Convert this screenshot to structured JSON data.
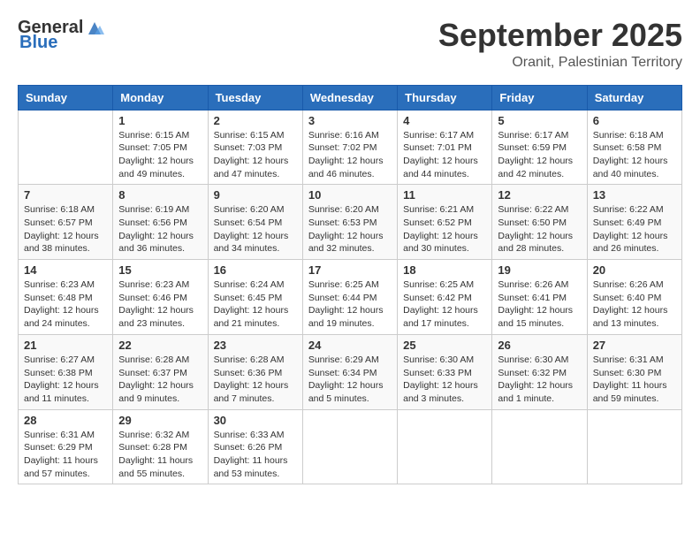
{
  "logo": {
    "general": "General",
    "blue": "Blue"
  },
  "header": {
    "month": "September 2025",
    "location": "Oranit, Palestinian Territory"
  },
  "weekdays": [
    "Sunday",
    "Monday",
    "Tuesday",
    "Wednesday",
    "Thursday",
    "Friday",
    "Saturday"
  ],
  "weeks": [
    [
      {
        "day": "",
        "info": ""
      },
      {
        "day": "1",
        "info": "Sunrise: 6:15 AM\nSunset: 7:05 PM\nDaylight: 12 hours\nand 49 minutes."
      },
      {
        "day": "2",
        "info": "Sunrise: 6:15 AM\nSunset: 7:03 PM\nDaylight: 12 hours\nand 47 minutes."
      },
      {
        "day": "3",
        "info": "Sunrise: 6:16 AM\nSunset: 7:02 PM\nDaylight: 12 hours\nand 46 minutes."
      },
      {
        "day": "4",
        "info": "Sunrise: 6:17 AM\nSunset: 7:01 PM\nDaylight: 12 hours\nand 44 minutes."
      },
      {
        "day": "5",
        "info": "Sunrise: 6:17 AM\nSunset: 6:59 PM\nDaylight: 12 hours\nand 42 minutes."
      },
      {
        "day": "6",
        "info": "Sunrise: 6:18 AM\nSunset: 6:58 PM\nDaylight: 12 hours\nand 40 minutes."
      }
    ],
    [
      {
        "day": "7",
        "info": "Sunrise: 6:18 AM\nSunset: 6:57 PM\nDaylight: 12 hours\nand 38 minutes."
      },
      {
        "day": "8",
        "info": "Sunrise: 6:19 AM\nSunset: 6:56 PM\nDaylight: 12 hours\nand 36 minutes."
      },
      {
        "day": "9",
        "info": "Sunrise: 6:20 AM\nSunset: 6:54 PM\nDaylight: 12 hours\nand 34 minutes."
      },
      {
        "day": "10",
        "info": "Sunrise: 6:20 AM\nSunset: 6:53 PM\nDaylight: 12 hours\nand 32 minutes."
      },
      {
        "day": "11",
        "info": "Sunrise: 6:21 AM\nSunset: 6:52 PM\nDaylight: 12 hours\nand 30 minutes."
      },
      {
        "day": "12",
        "info": "Sunrise: 6:22 AM\nSunset: 6:50 PM\nDaylight: 12 hours\nand 28 minutes."
      },
      {
        "day": "13",
        "info": "Sunrise: 6:22 AM\nSunset: 6:49 PM\nDaylight: 12 hours\nand 26 minutes."
      }
    ],
    [
      {
        "day": "14",
        "info": "Sunrise: 6:23 AM\nSunset: 6:48 PM\nDaylight: 12 hours\nand 24 minutes."
      },
      {
        "day": "15",
        "info": "Sunrise: 6:23 AM\nSunset: 6:46 PM\nDaylight: 12 hours\nand 23 minutes."
      },
      {
        "day": "16",
        "info": "Sunrise: 6:24 AM\nSunset: 6:45 PM\nDaylight: 12 hours\nand 21 minutes."
      },
      {
        "day": "17",
        "info": "Sunrise: 6:25 AM\nSunset: 6:44 PM\nDaylight: 12 hours\nand 19 minutes."
      },
      {
        "day": "18",
        "info": "Sunrise: 6:25 AM\nSunset: 6:42 PM\nDaylight: 12 hours\nand 17 minutes."
      },
      {
        "day": "19",
        "info": "Sunrise: 6:26 AM\nSunset: 6:41 PM\nDaylight: 12 hours\nand 15 minutes."
      },
      {
        "day": "20",
        "info": "Sunrise: 6:26 AM\nSunset: 6:40 PM\nDaylight: 12 hours\nand 13 minutes."
      }
    ],
    [
      {
        "day": "21",
        "info": "Sunrise: 6:27 AM\nSunset: 6:38 PM\nDaylight: 12 hours\nand 11 minutes."
      },
      {
        "day": "22",
        "info": "Sunrise: 6:28 AM\nSunset: 6:37 PM\nDaylight: 12 hours\nand 9 minutes."
      },
      {
        "day": "23",
        "info": "Sunrise: 6:28 AM\nSunset: 6:36 PM\nDaylight: 12 hours\nand 7 minutes."
      },
      {
        "day": "24",
        "info": "Sunrise: 6:29 AM\nSunset: 6:34 PM\nDaylight: 12 hours\nand 5 minutes."
      },
      {
        "day": "25",
        "info": "Sunrise: 6:30 AM\nSunset: 6:33 PM\nDaylight: 12 hours\nand 3 minutes."
      },
      {
        "day": "26",
        "info": "Sunrise: 6:30 AM\nSunset: 6:32 PM\nDaylight: 12 hours\nand 1 minute."
      },
      {
        "day": "27",
        "info": "Sunrise: 6:31 AM\nSunset: 6:30 PM\nDaylight: 11 hours\nand 59 minutes."
      }
    ],
    [
      {
        "day": "28",
        "info": "Sunrise: 6:31 AM\nSunset: 6:29 PM\nDaylight: 11 hours\nand 57 minutes."
      },
      {
        "day": "29",
        "info": "Sunrise: 6:32 AM\nSunset: 6:28 PM\nDaylight: 11 hours\nand 55 minutes."
      },
      {
        "day": "30",
        "info": "Sunrise: 6:33 AM\nSunset: 6:26 PM\nDaylight: 11 hours\nand 53 minutes."
      },
      {
        "day": "",
        "info": ""
      },
      {
        "day": "",
        "info": ""
      },
      {
        "day": "",
        "info": ""
      },
      {
        "day": "",
        "info": ""
      }
    ]
  ]
}
